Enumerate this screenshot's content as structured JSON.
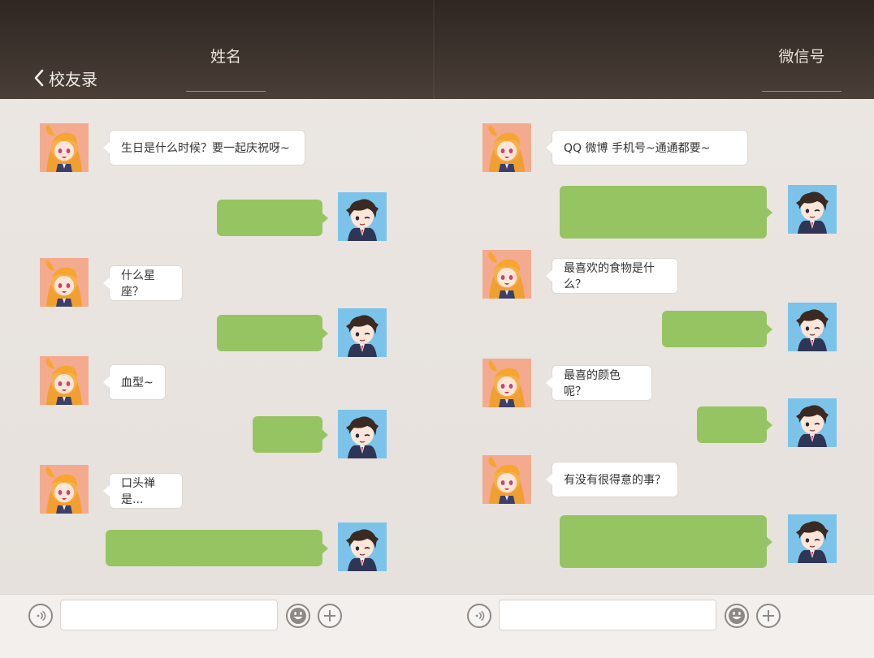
{
  "header": {
    "back_label": "校友录",
    "name_label": "姓名",
    "wechat_label": "微信号"
  },
  "left_chat": {
    "questions": [
      "生日是什么时候？要一起庆祝呀~",
      "什么星座？",
      "血型~",
      "口头禅是..."
    ]
  },
  "right_chat": {
    "questions": [
      "QQ 微博 手机号~通通都要~",
      "最喜欢的食物是什么？",
      "最喜的颜色呢？",
      "有没有很得意的事？"
    ]
  },
  "input_bar": {
    "left_input_value": "",
    "right_input_value": ""
  },
  "colors": {
    "header_bg": "#3a302a",
    "green_bubble": "#97c463",
    "girl_avatar_bg": "#f3aa8e",
    "boy_avatar_bg": "#7cc3ea"
  },
  "icons": [
    "chevron-left-icon",
    "voice-icon",
    "emoji-icon",
    "plus-icon",
    "girl-avatar",
    "boy-avatar"
  ]
}
